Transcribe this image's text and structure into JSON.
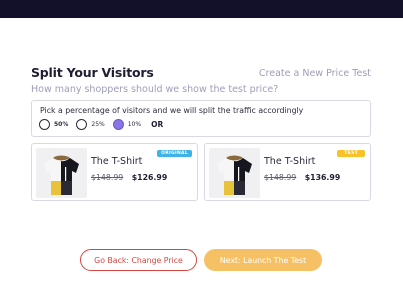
{
  "header": {
    "title": "Split Your Visitors",
    "create_link": "Create a New Price Test",
    "subtitle": "How many shoppers should we show the test price?"
  },
  "split": {
    "label": "Pick a percentage of visitors and we will split the traffic accordingly",
    "options": [
      {
        "label": "50%",
        "checked": false
      },
      {
        "label": "25%",
        "checked": false
      },
      {
        "label": "10%",
        "checked": true
      }
    ],
    "or_label": "OR"
  },
  "cards": [
    {
      "name": "The T-Shirt",
      "old_price": "$148.99",
      "new_price": "$126.99",
      "badge": "ORIGINAL",
      "badge_color": "#3fb2e6"
    },
    {
      "name": "The T-Shirt",
      "old_price": "$148.99",
      "new_price": "$136.99",
      "badge": "TEST",
      "badge_color": "#f7c12a"
    }
  ],
  "actions": {
    "back_label": "Go Back: Change Price",
    "next_label": "Next: Launch The Test"
  },
  "colors": {
    "topbar": "#13102a",
    "accent_red": "#d6463f",
    "accent_yellow": "#f5c164",
    "radio_selected": "#8b74e6"
  }
}
